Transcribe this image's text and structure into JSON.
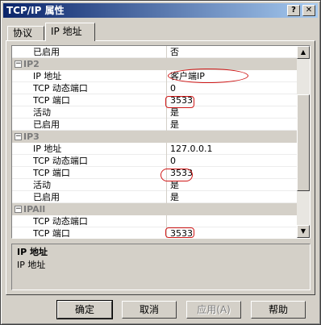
{
  "window": {
    "title": "TCP/IP 属性",
    "help_glyph": "?",
    "close_glyph": "✕"
  },
  "tabs": [
    {
      "label": "协议"
    },
    {
      "label": "IP 地址"
    }
  ],
  "grid": {
    "rows": [
      {
        "kind": "prop",
        "name": "已启用",
        "value": "否"
      },
      {
        "kind": "cat",
        "name": "IP2",
        "expander": "−"
      },
      {
        "kind": "prop",
        "name": "IP 地址",
        "value": "客户端IP"
      },
      {
        "kind": "prop",
        "name": "TCP 动态端口",
        "value": "0"
      },
      {
        "kind": "prop",
        "name": "TCP 端口",
        "value": "3533"
      },
      {
        "kind": "prop",
        "name": "活动",
        "value": "是"
      },
      {
        "kind": "prop",
        "name": "已启用",
        "value": "是"
      },
      {
        "kind": "cat",
        "name": "IP3",
        "expander": "−"
      },
      {
        "kind": "prop",
        "name": "IP 地址",
        "value": "127.0.0.1"
      },
      {
        "kind": "prop",
        "name": "TCP 动态端口",
        "value": "0"
      },
      {
        "kind": "prop",
        "name": "TCP 端口",
        "value": "3533"
      },
      {
        "kind": "prop",
        "name": "活动",
        "value": "是"
      },
      {
        "kind": "prop",
        "name": "已启用",
        "value": "是"
      },
      {
        "kind": "cat",
        "name": "IPAll",
        "expander": "−"
      },
      {
        "kind": "prop",
        "name": "TCP 动态端口",
        "value": ""
      },
      {
        "kind": "prop",
        "name": "TCP 端口",
        "value": "3533"
      }
    ],
    "scroll_up_glyph": "▲",
    "scroll_down_glyph": "▼"
  },
  "description": {
    "title": "IP 地址",
    "text": "IP 地址"
  },
  "buttons": {
    "ok": "确定",
    "cancel": "取消",
    "apply": "应用(A)",
    "help": "帮助"
  }
}
